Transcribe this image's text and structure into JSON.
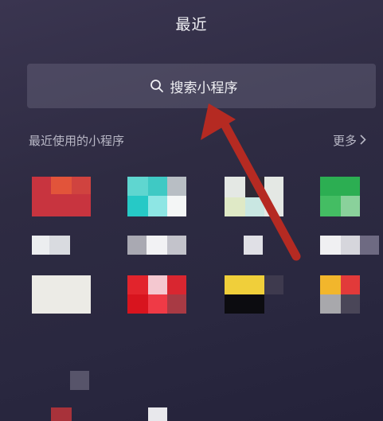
{
  "header": {
    "title": "最近"
  },
  "search": {
    "label": "搜索小程序"
  },
  "recent": {
    "section_title": "最近使用的小程序",
    "more_label": "更多"
  },
  "colors": {
    "arrow": "#b52a22"
  }
}
